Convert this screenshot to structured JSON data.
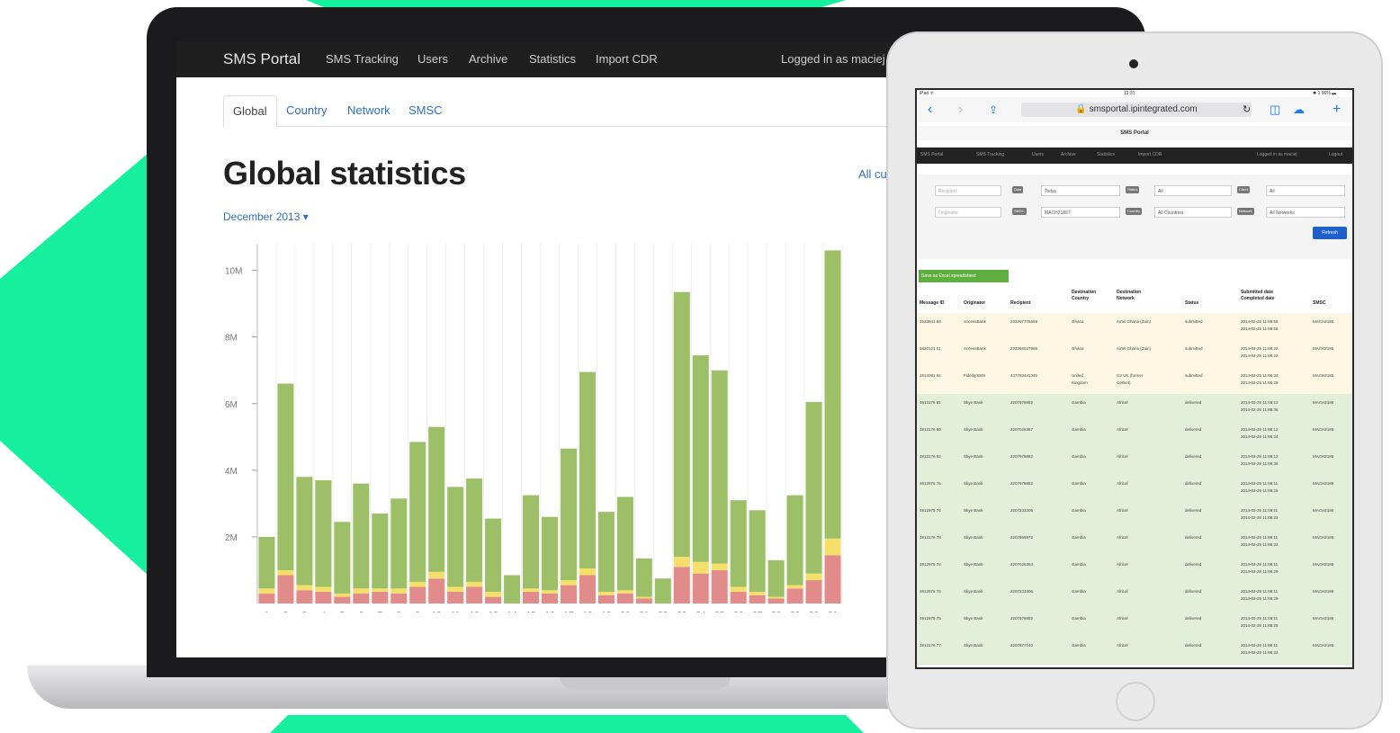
{
  "colors": {
    "accent_green": "#16f09e",
    "bar_green": "#9cbf68",
    "bar_yellow": "#f3df6a",
    "bar_red": "#e28b8b"
  },
  "laptop": {
    "nav": {
      "brand": "SMS Portal",
      "items": [
        "SMS Tracking",
        "Users",
        "Archive",
        "Statistics",
        "Import CDR"
      ],
      "logged_in": "Logged in as maciej"
    },
    "tabs": [
      "Global",
      "Country",
      "Network",
      "SMSC"
    ],
    "title": "Global statistics",
    "all_link": "All cu",
    "month": "December 2013 ▾"
  },
  "chart_data": {
    "type": "bar",
    "stacked": true,
    "categories": [
      "1",
      "2",
      "3",
      "4",
      "5",
      "6",
      "7",
      "8",
      "9",
      "10",
      "11",
      "12",
      "13",
      "14",
      "15",
      "16",
      "17",
      "18",
      "19",
      "20",
      "21",
      "22",
      "23",
      "24",
      "25",
      "26",
      "27",
      "28",
      "29",
      "30",
      "31"
    ],
    "y_ticks": [
      "10M",
      "8M",
      "6M",
      "4M",
      "2M"
    ],
    "ylim": [
      0,
      10800000
    ],
    "grid": true,
    "series": [
      {
        "color": "#e28b8b",
        "values": [
          300000,
          850000,
          400000,
          350000,
          200000,
          300000,
          350000,
          300000,
          500000,
          750000,
          350000,
          500000,
          200000,
          0,
          350000,
          300000,
          550000,
          850000,
          250000,
          300000,
          150000,
          0,
          1100000,
          900000,
          1000000,
          350000,
          250000,
          150000,
          450000,
          700000,
          1450000
        ]
      },
      {
        "color": "#f3df6a",
        "values": [
          150000,
          150000,
          150000,
          150000,
          100000,
          150000,
          100000,
          150000,
          150000,
          200000,
          150000,
          150000,
          150000,
          0,
          100000,
          100000,
          150000,
          200000,
          100000,
          100000,
          50000,
          0,
          300000,
          350000,
          200000,
          150000,
          100000,
          50000,
          100000,
          200000,
          500000
        ]
      },
      {
        "color": "#9cbf68",
        "values": [
          1550000,
          5600000,
          3250000,
          3200000,
          2150000,
          3150000,
          2250000,
          2700000,
          4200000,
          4350000,
          3000000,
          3100000,
          2200000,
          850000,
          2800000,
          2200000,
          3950000,
          5900000,
          2400000,
          2800000,
          1150000,
          750000,
          7950000,
          6200000,
          5800000,
          2600000,
          2450000,
          1100000,
          2700000,
          5150000,
          8650000
        ]
      }
    ]
  },
  "tablet": {
    "status_left": "iPad ᯤ",
    "status_time": "12:31",
    "status_right": "✱ 1 96% ▬",
    "url": "🔒 smsportal.ipintegrated.com",
    "page_title": "SMS Portal",
    "nav": {
      "brand": "SMS Portal",
      "items": [
        "SMS Tracking",
        "Users",
        "Archive",
        "Statistics",
        "Import CDR"
      ],
      "logged_in": "Logged in as maciej",
      "logout": "Logout"
    },
    "filters": {
      "recipient_placeholder": "Recipient",
      "originator_placeholder": "Originator",
      "date_label": "Date",
      "date_value": "Today",
      "status_label": "Status",
      "status_value": "All",
      "client_label": "Client",
      "client_value": "All",
      "smsc_label": "SMSC",
      "smsc_value": "MACH21867",
      "country_label": "Country",
      "country_value": "All Countries",
      "network_label": "Network",
      "network_value": "All Networks",
      "refresh": "Refresh"
    },
    "excel_button": "Save as Excel spreadsheet",
    "table": {
      "headers": [
        "Message ID",
        "Originator",
        "Recipient",
        "Destination\nCountry",
        "Destination\nNetwork",
        "Status",
        "Submitted date\nCompleted date",
        "SMSC"
      ],
      "rows": [
        [
          "4623641 60",
          "AccessBank",
          "233267775658",
          "Ghana",
          "Airtel Ghana (Zain)",
          "submitted",
          "2014-02-25 11:09:56\n2014-02-25 11:09:56",
          "MACH2186"
        ],
        [
          "4620121 01",
          "AccessBank",
          "233266027986",
          "Ghana",
          "Airtel Ghana (Zain)",
          "submitted",
          "2014-02-25 11:09:22\n2014-02-25 11:09:22",
          "MACH2186"
        ],
        [
          "4814081 84",
          "FidelitySMS",
          "447763441345",
          "United\nKingdom",
          "O2 UK (former\nCellnet)",
          "submitted",
          "2014-02-25 11:08:24\n2014-02-25 11:08:29",
          "MACH2186"
        ],
        [
          "4813176 81",
          "Skye Bank",
          "2207979882",
          "Gambia",
          "Africel",
          "delivered",
          "2014-02-25 11:08:12\n2014-02-25 11:08:36",
          "MACH2186"
        ],
        [
          "4813176 80",
          "Skye Bank",
          "2207026367",
          "Gambia",
          "Africel",
          "delivered",
          "2014-02-25 11:08:12\n2014-02-25 11:08:24",
          "MACH2186"
        ],
        [
          "4813176 82",
          "Skye Bank",
          "2207979882",
          "Gambia",
          "Africel",
          "delivered",
          "2014-02-25 11:08:12\n2014-02-25 11:08:36",
          "MACH2186"
        ],
        [
          "4812975 76",
          "Skye Bank",
          "2207979882",
          "Gambia",
          "Africel",
          "delivered",
          "2014-02-25 11:08:11\n2014-02-25 11:08:26",
          "MACH2186"
        ],
        [
          "4812975 74",
          "Skye Bank",
          "2207233306",
          "Gambia",
          "Africel",
          "delivered",
          "2014-02-25 11:08:11\n2014-02-25 11:08:22",
          "MACH2186"
        ],
        [
          "4813176 78",
          "Skye Bank",
          "2207869572",
          "Gambia",
          "Africel",
          "delivered",
          "2014-02-25 11:08:11\n2014-02-25 11:08:22",
          "MACH2186"
        ],
        [
          "4812975 72",
          "Skye Bank",
          "2207026364",
          "Gambia",
          "Africel",
          "delivered",
          "2014-02-25 11:08:11\n2014-02-25 11:08:29",
          "MACH2186"
        ],
        [
          "4812975 75",
          "Skye Bank",
          "2207233306",
          "Gambia",
          "Africel",
          "delivered",
          "2014-02-25 11:08:11\n2014-02-25 11:08:29",
          "MACH2186"
        ],
        [
          "4812975 73",
          "Skye Bank",
          "2207979882",
          "Gambia",
          "Africel",
          "delivered",
          "2014-02-25 11:08:11\n2014-02-25 11:08:25",
          "MACH2186"
        ],
        [
          "4813176 77",
          "Skye Bank",
          "2207877140",
          "Gambia",
          "Africel",
          "delivered",
          "2014-02-25 11:08:11\n2014-02-25 11:08:22",
          "MACH2186"
        ]
      ]
    }
  }
}
